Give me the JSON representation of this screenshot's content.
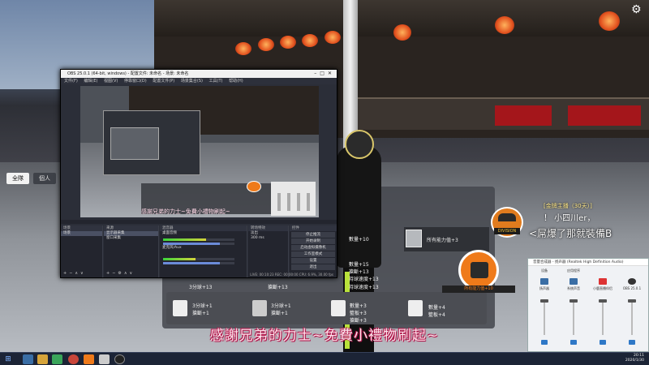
{
  "game": {
    "tabs": [
      "全隊",
      "個人"
    ],
    "panel": {
      "team_header": "所有能力值+3",
      "lines": [
        {
          "text": "數量+10"
        },
        {
          "text": "數量+15"
        },
        {
          "text": "搶斷+13"
        },
        {
          "text": "持球速度+13"
        },
        {
          "text": "持球速度+13"
        },
        {
          "text": "3分球+13"
        },
        {
          "text": "搶斷+13"
        },
        {
          "text": "3分球+1"
        },
        {
          "text": "搶斷+1"
        },
        {
          "text": "3分球+1"
        },
        {
          "text": "搶斷+1"
        },
        {
          "text": "數量+3"
        },
        {
          "text": "籃板+3"
        },
        {
          "text": "搶斷+3"
        },
        {
          "text": "數量+4"
        },
        {
          "text": "籃板+4"
        }
      ]
    },
    "badge_label": "所有能力值+10",
    "thanks_banner": "感謝兄弟的力士~免費小禮物刷起~"
  },
  "chat": {
    "meta": "[金牌主播（30天）]",
    "user": "！ 小四川er，",
    "message": "<屌爆了那就裝備B",
    "avatar_text": "DIVISION"
  },
  "obs": {
    "title": "OBS 25.0.1 (64-bit, windows) - 配置文件: 未命名 - 场景: 未命名",
    "menu": [
      "文件(F)",
      "编辑(E)",
      "视图(V)",
      "停靠窗口(D)",
      "配置文件(P)",
      "场景集合(S)",
      "工具(T)",
      "帮助(H)"
    ],
    "docks": {
      "scenes": {
        "header": "场景",
        "items": [
          "场景"
        ]
      },
      "sources": {
        "header": "来源",
        "items": [
          "显示器采集",
          "窗口采集"
        ]
      },
      "mixer": {
        "header": "混音器",
        "channels": [
          "桌面音频",
          "麦克风/Aux"
        ]
      },
      "transitions": {
        "header": "转场特效",
        "value": "淡出",
        "duration": "300 ms"
      },
      "controls": {
        "header": "控件",
        "buttons": [
          "停止推流",
          "开始录制",
          "启动虚拟摄像机",
          "工作室模式",
          "设置",
          "退出"
        ]
      }
    },
    "status": "LIVE: 00:10:23   REC: 00:00:00   CPU: 6.9%, 30.00 fps"
  },
  "mixer_window": {
    "title": "音量合成器 - 扬声器 (Realtek High Definition Audio)",
    "columns": [
      {
        "group": "设备",
        "name": "扬声器",
        "level": 0.9
      },
      {
        "group": "应用程序",
        "name": "系统声音",
        "level": 0.9
      },
      {
        "group": "",
        "name": "小鹿直播伴侣",
        "level": 0.9
      },
      {
        "group": "",
        "name": "OBS 25.0.1",
        "level": 0.9
      }
    ]
  },
  "taskbar": {
    "clock_time": "20:11",
    "clock_date": "2020/1/30"
  },
  "colors": {
    "accent_orange": "#ef7a1a",
    "lantern": "#e2521f",
    "chat_meta": "#ffe98a",
    "banner_pink": "#b0164a"
  }
}
